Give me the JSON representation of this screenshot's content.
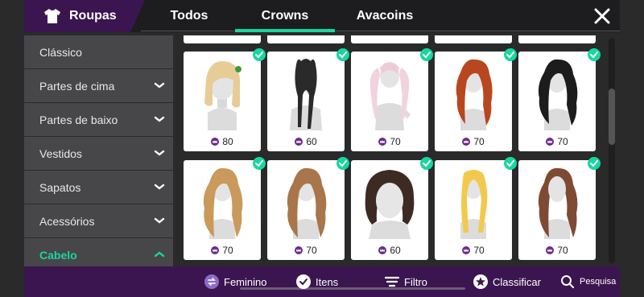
{
  "header": {
    "category": "Roupas",
    "tabs": [
      "Todos",
      "Crowns",
      "Avacoins"
    ],
    "active_tab": "Crowns"
  },
  "sidebar": {
    "items": [
      {
        "label": "Clássico",
        "chevron": "none"
      },
      {
        "label": "Partes de cima",
        "chevron": "down"
      },
      {
        "label": "Partes de baixo",
        "chevron": "down"
      },
      {
        "label": "Vestidos",
        "chevron": "down"
      },
      {
        "label": "Sapatos",
        "chevron": "down"
      },
      {
        "label": "Acessórios",
        "chevron": "down"
      },
      {
        "label": "Cabelo",
        "chevron": "up",
        "active": true
      }
    ]
  },
  "items": {
    "row1": [
      {
        "price": "80",
        "hair": "blonde-bob"
      },
      {
        "price": "60",
        "hair": "black-braids"
      },
      {
        "price": "70",
        "hair": "pink-pigtails"
      },
      {
        "price": "70",
        "hair": "red-waves"
      },
      {
        "price": "70",
        "hair": "black-waves"
      }
    ],
    "row2": [
      {
        "price": "70",
        "hair": "caramel-waves"
      },
      {
        "price": "70",
        "hair": "light-brown-waves"
      },
      {
        "price": "60",
        "hair": "dark-short-bob"
      },
      {
        "price": "70",
        "hair": "golden-long"
      },
      {
        "price": "70",
        "hair": "auburn-long"
      }
    ]
  },
  "bottom": {
    "gender": "Feminino",
    "items": "Itens",
    "filter": "Filtro",
    "sort": "Classificar",
    "search": "Pesquisa"
  },
  "colors": {
    "accent": "#17d7a0",
    "bar_purple": "#3b1550",
    "crown_purple": "#6a2a8a"
  }
}
